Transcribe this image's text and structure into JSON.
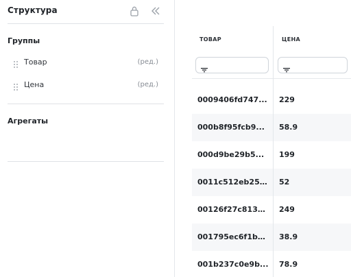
{
  "sidebar": {
    "title": "Структура",
    "groups_title": "Группы",
    "groups": [
      {
        "label": "Товар",
        "edit": "(ред.)"
      },
      {
        "label": "Цена",
        "edit": "(ред.)"
      }
    ],
    "aggregates_title": "Агрегаты"
  },
  "table": {
    "columns": [
      "ТОВАР",
      "ЦЕНА"
    ],
    "rows": [
      {
        "id": "0009406fd747...",
        "price": "229"
      },
      {
        "id": "000b8f95fcb9...",
        "price": "58.9"
      },
      {
        "id": "000d9be29b5...",
        "price": "199"
      },
      {
        "id": "0011c512eb256...",
        "price": "52"
      },
      {
        "id": "00126f27c8136...",
        "price": "249"
      },
      {
        "id": "001795ec6f1b1...",
        "price": "38.9"
      },
      {
        "id": "001b237c0e9b...",
        "price": "78.9"
      }
    ]
  },
  "icons": {
    "lock": "lock-icon",
    "collapse": "double-chevron-left-icon",
    "drag": "drag-handle-icon",
    "filter": "filter-icon"
  },
  "colors": {
    "border": "#dfe2e6",
    "muted_text": "#868b93",
    "row_alt": "#f6f7f9"
  }
}
